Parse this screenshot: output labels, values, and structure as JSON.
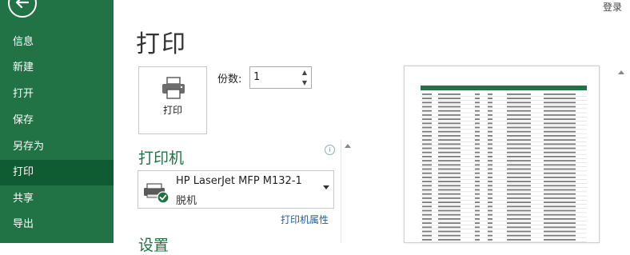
{
  "nav": {
    "items": [
      {
        "label": "信息",
        "active": false
      },
      {
        "label": "新建",
        "active": false
      },
      {
        "label": "打开",
        "active": false
      },
      {
        "label": "保存",
        "active": false
      },
      {
        "label": "另存为",
        "active": false
      },
      {
        "label": "打印",
        "active": true
      },
      {
        "label": "共享",
        "active": false
      },
      {
        "label": "导出",
        "active": false
      }
    ]
  },
  "header": {
    "login_label": "登录",
    "title": "打印"
  },
  "print_button": {
    "label": "打印"
  },
  "copies": {
    "label": "份数:",
    "value": "1"
  },
  "printer": {
    "section_title": "打印机",
    "name": "HP LaserJet MFP M132-1",
    "status": "脱机",
    "properties_link": "打印机属性"
  },
  "settings": {
    "section_title": "设置"
  },
  "colors": {
    "accent": "#217346",
    "active_nav": "#0f5b32",
    "link": "#1e5ea6"
  }
}
